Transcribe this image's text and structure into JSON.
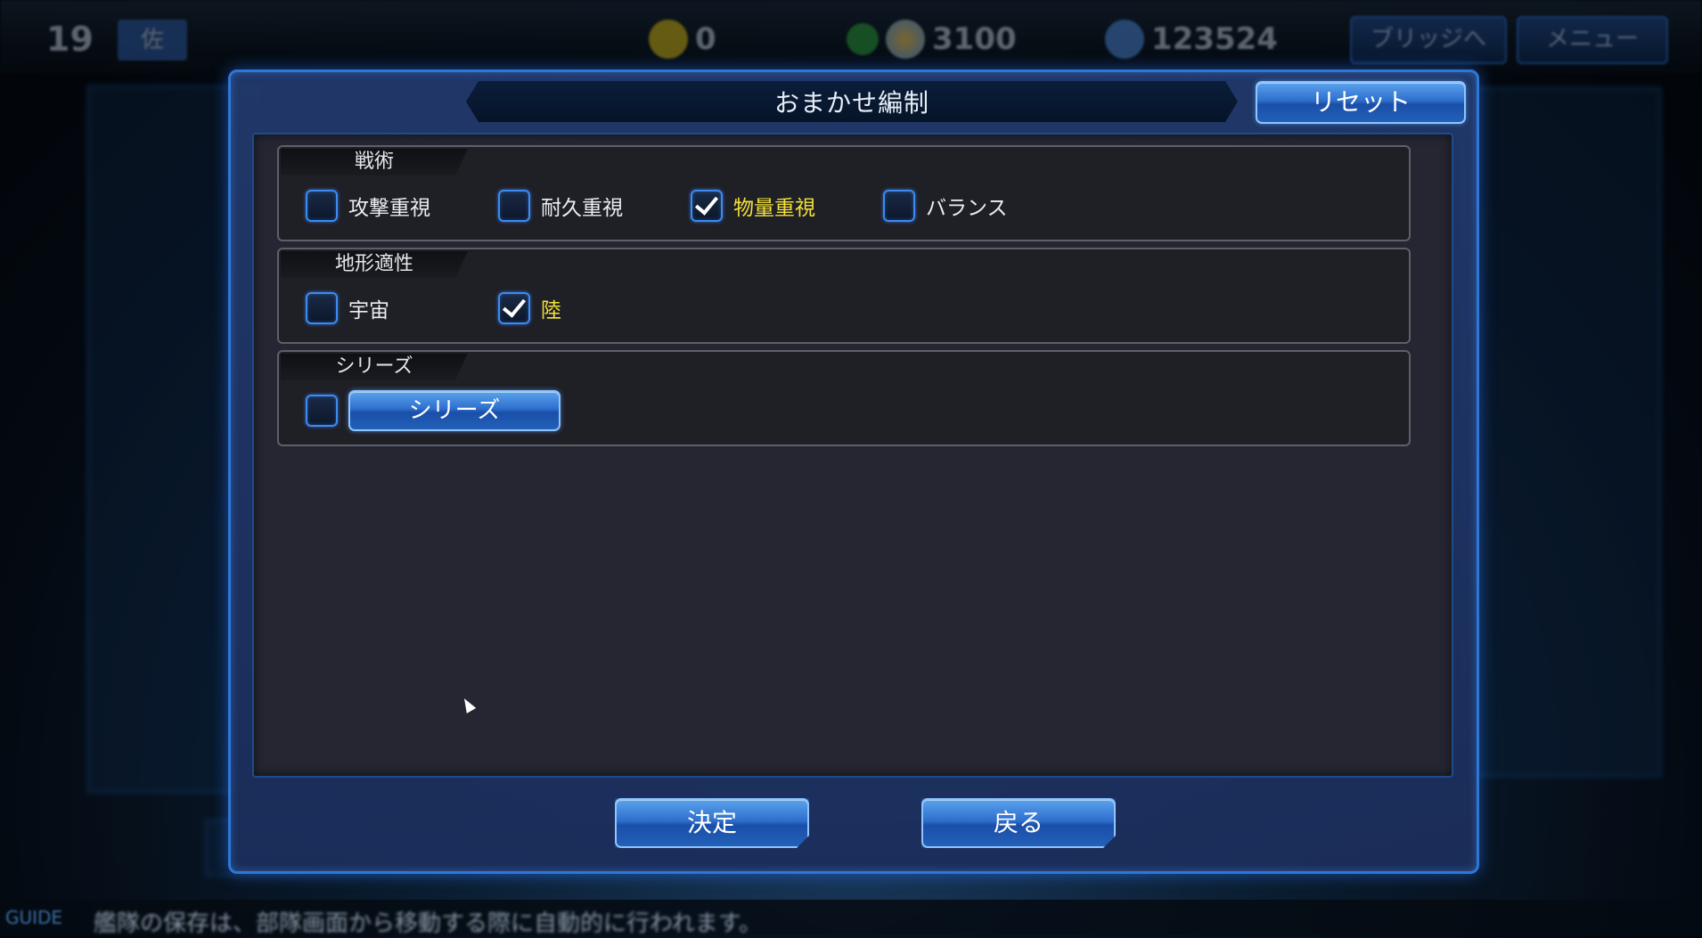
{
  "topbar": {
    "level": "19",
    "rank": "佐",
    "coin_value": "0",
    "capital_value": "3100",
    "gem_value": "123524",
    "bridge_label": "ブリッジへ",
    "menu_label": "メニュー"
  },
  "modal": {
    "title": "おまかせ編制",
    "reset_label": "リセット",
    "sections": {
      "tactics": {
        "label": "戦術",
        "options": [
          {
            "label": "攻撃重視",
            "checked": false
          },
          {
            "label": "耐久重視",
            "checked": false
          },
          {
            "label": "物量重視",
            "checked": true
          },
          {
            "label": "バランス",
            "checked": false
          }
        ]
      },
      "terrain": {
        "label": "地形適性",
        "options": [
          {
            "label": "宇宙",
            "checked": false
          },
          {
            "label": "陸",
            "checked": true
          }
        ]
      },
      "series": {
        "label": "シリーズ",
        "checked": false,
        "button_label": "シリーズ"
      }
    },
    "ok_label": "決定",
    "back_label": "戻る"
  },
  "guide": {
    "label": "GUIDE",
    "text": "艦隊の保存は、部隊画面から移動する際に自動的に行われます。"
  },
  "colors": {
    "accent": "#2f77d6",
    "active_label": "#f2e23a",
    "panel_bg": "#26262e"
  }
}
